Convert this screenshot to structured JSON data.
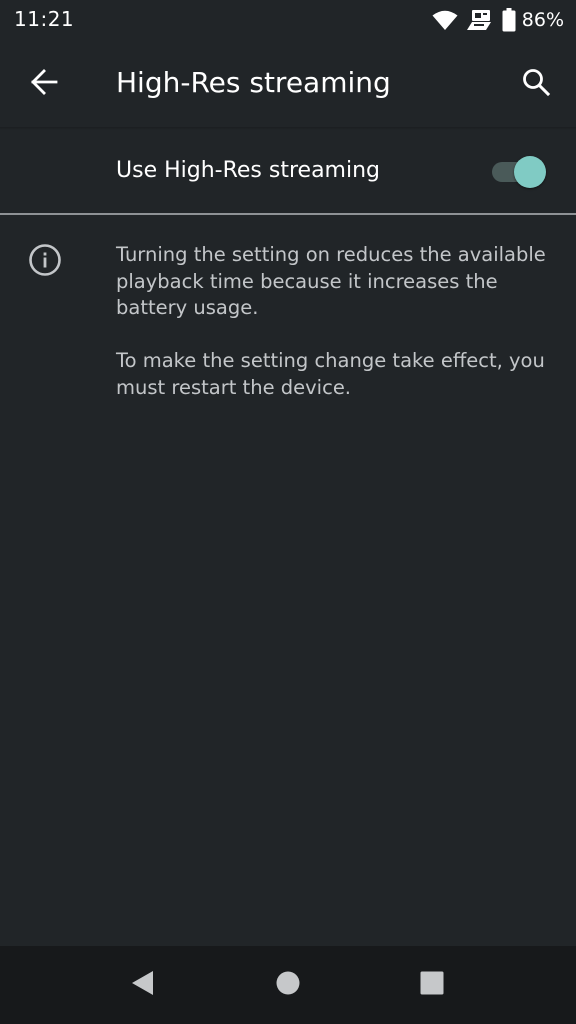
{
  "status_bar": {
    "time": "11:21",
    "battery_percent": "86%",
    "icons": [
      "wifi-icon",
      "hi-res-audio-icon",
      "battery-icon"
    ]
  },
  "app_bar": {
    "title": "High-Res streaming",
    "back_icon": "arrow-back-icon",
    "search_icon": "search-icon"
  },
  "setting": {
    "label": "Use High-Res streaming",
    "enabled": true
  },
  "info": {
    "icon": "info-icon",
    "paragraph_1": "Turning the setting on reduces the available playback time because it increases the battery usage.",
    "paragraph_2": "To make the setting change take effect, you must restart the device."
  },
  "nav_bar": {
    "icons": [
      "nav-back-icon",
      "nav-home-icon",
      "nav-recents-icon"
    ]
  },
  "colors": {
    "background": "#212528",
    "accent": "#80cbc4",
    "text_primary": "#ffffff",
    "text_secondary": "#c3c6c9",
    "nav_bar": "#17191b"
  }
}
